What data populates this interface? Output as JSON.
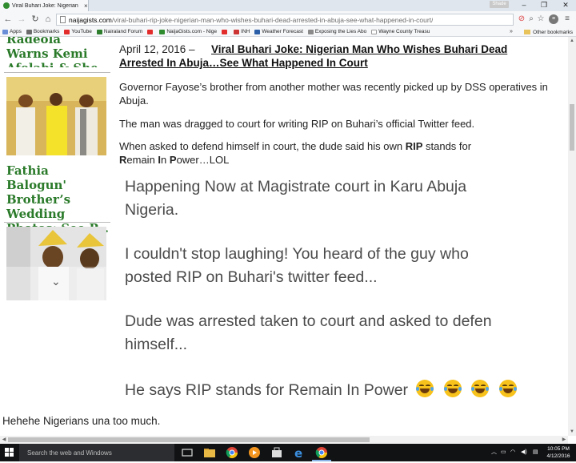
{
  "browser": {
    "tab_title": "Viral Buhari Joke: Nigerian",
    "tab_close": "×",
    "user_badge": "Shade",
    "url_host": "naijagists.com",
    "url_path": "/viral-buhari-rip-joke-nigerian-man-who-wishes-buhari-dead-arrested-in-abuja-see-what-happened-in-court/",
    "bookmarks": [
      {
        "label": "Apps",
        "color": "#6a8fd8"
      },
      {
        "label": "Bookmarks",
        "color": "#6b6b6b"
      },
      {
        "label": "YouTube",
        "color": "#e22b2b"
      },
      {
        "label": "Nairaland Forum",
        "color": "#2d7d2d"
      },
      {
        "label": "",
        "color": "#e22b2b"
      },
      {
        "label": "NaijaGists.com - Nige",
        "color": "#2e8b2e"
      },
      {
        "label": "",
        "color": "#e22b2b"
      },
      {
        "label": "INH",
        "color": "#c33"
      },
      {
        "label": "Weather Forecast",
        "color": "#2a5fa8"
      },
      {
        "label": "Exposing the Lies Abo",
        "color": "#8a8a8a"
      },
      {
        "label": "Wayne County Treasu",
        "color": "#bbbbbb"
      }
    ],
    "bookmarks_overflow": "»",
    "other_bookmarks": "Other bookmarks"
  },
  "sidebar": {
    "title1": "Radeola Warns Kemi Afolabi & She Baby ...",
    "title2": "Fathia Balogun' Brother’s Wedding Photos: See P..."
  },
  "article": {
    "date": "April 12, 2016 –",
    "title_line1": "Viral Buhari Joke: Nigerian Man Who Wishes Buhari Dead",
    "title_line2": "Arrested In Abuja…See What Happened In Court",
    "p1": "Governor Fayose’s brother from another mother was recently picked up by DSS operatives in Abuja.",
    "p2": "The man was dragged to court for writing RIP on Buhari’s official Twitter feed.",
    "p3_start": "When asked to defend himself in court, the dude said his own ",
    "p3_rip": "RIP",
    "p3_mid": " stands for",
    "p3_r": "R",
    "p3_emain": "emain ",
    "p3_i": "I",
    "p3_n": "n ",
    "p3_p": "P",
    "p3_ower": "ower…LOL",
    "shot_lines": [
      "Happening Now at Magistrate court in Karu Abuja",
      "Nigeria.",
      "I couldn't stop laughing! You heard of the guy who",
      "posted RIP on Buhari's twitter feed...",
      "Dude was arrested taken to court and asked to defen",
      "himself...",
      "He says RIP stands for Remain In Power"
    ],
    "footer": "Hehehe Nigerians una too much."
  },
  "taskbar": {
    "search_placeholder": "Search the web and Windows",
    "time": "10:05 PM",
    "date": "4/12/2016"
  },
  "colors": {
    "sidebar_title": "#2a7a2a",
    "emoji": "#f7c21b",
    "taskbar": "#101214"
  }
}
